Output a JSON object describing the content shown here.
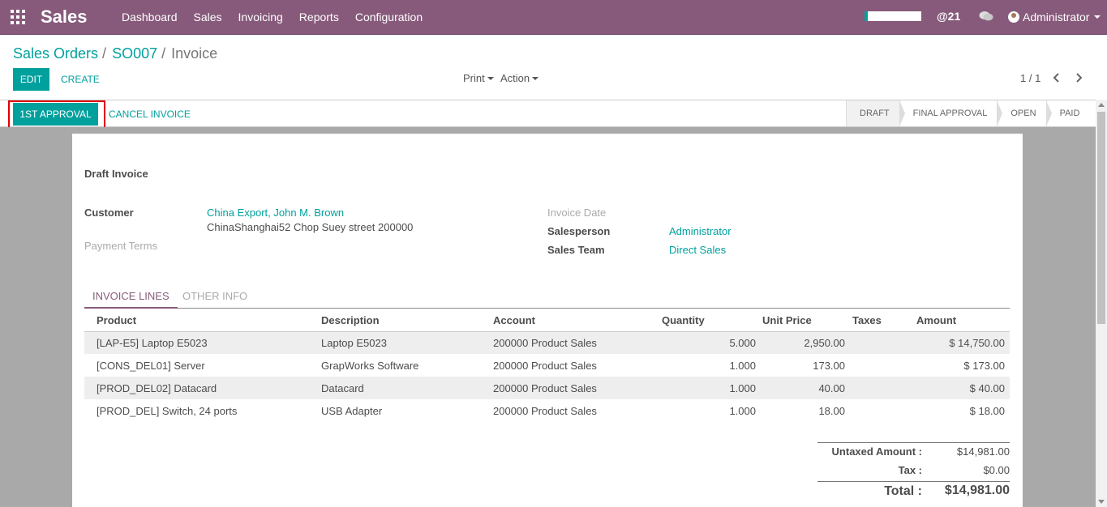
{
  "navbar": {
    "brand": "Sales",
    "menu": [
      "Dashboard",
      "Sales",
      "Invoicing",
      "Reports",
      "Configuration"
    ],
    "messages_count": "@21",
    "user": "Administrator"
  },
  "breadcrumb": {
    "items": [
      "Sales Orders",
      "SO007"
    ],
    "current": "Invoice",
    "separator": "/"
  },
  "controls": {
    "edit": "EDIT",
    "create": "CREATE",
    "print": "Print",
    "action": "Action",
    "pager": "1 / 1"
  },
  "statusbar": {
    "approval": "1ST APPROVAL",
    "cancel": "CANCEL INVOICE",
    "stages": [
      "DRAFT",
      "FINAL APPROVAL",
      "OPEN",
      "PAID"
    ],
    "active_stage": "DRAFT"
  },
  "invoice": {
    "title": "Draft Invoice",
    "customer_label": "Customer",
    "customer_name": "China Export, John M. Brown",
    "customer_address": "ChinaShanghai52 Chop Suey street 200000",
    "payment_terms_label": "Payment Terms",
    "invoice_date_label": "Invoice Date",
    "salesperson_label": "Salesperson",
    "salesperson": "Administrator",
    "sales_team_label": "Sales Team",
    "sales_team": "Direct Sales"
  },
  "tabs": [
    "INVOICE LINES",
    "OTHER INFO"
  ],
  "lines": {
    "columns": [
      "Product",
      "Description",
      "Account",
      "Quantity",
      "Unit Price",
      "Taxes",
      "Amount"
    ],
    "rows": [
      [
        "[LAP-E5] Laptop E5023",
        "Laptop E5023",
        "200000 Product Sales",
        "5.000",
        "2,950.00",
        "",
        "$ 14,750.00"
      ],
      [
        "[CONS_DEL01] Server",
        "GrapWorks Software",
        "200000 Product Sales",
        "1.000",
        "173.00",
        "",
        "$ 173.00"
      ],
      [
        "[PROD_DEL02] Datacard",
        "Datacard",
        "200000 Product Sales",
        "1.000",
        "40.00",
        "",
        "$ 40.00"
      ],
      [
        "[PROD_DEL] Switch, 24 ports",
        "USB Adapter",
        "200000 Product Sales",
        "1.000",
        "18.00",
        "",
        "$ 18.00"
      ]
    ]
  },
  "totals": {
    "untaxed_label": "Untaxed Amount :",
    "untaxed": "$14,981.00",
    "tax_label": "Tax :",
    "tax": "$0.00",
    "total_label": "Total :",
    "total": "$14,981.00"
  },
  "colors": {
    "brand": "#875A7B",
    "accent": "#00A09D",
    "highlight": "#e00000"
  }
}
